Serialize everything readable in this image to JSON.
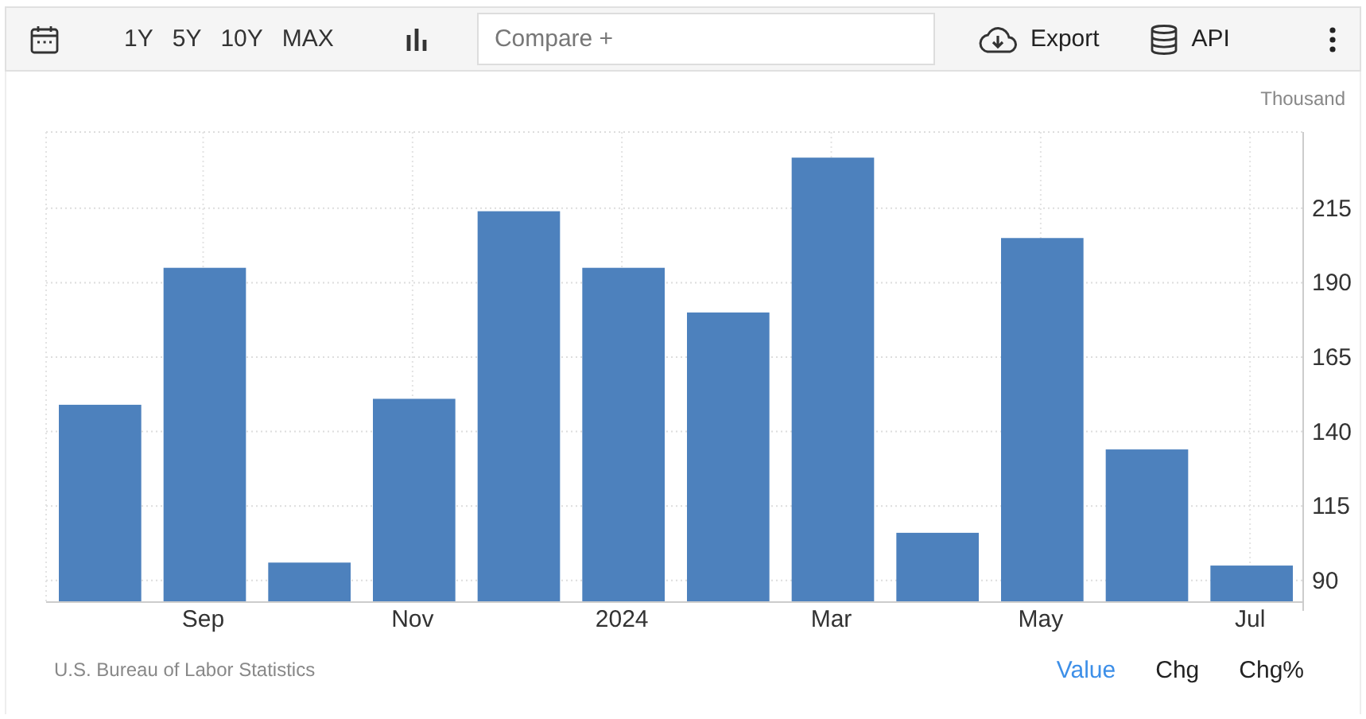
{
  "toolbar": {
    "ranges": [
      {
        "label": "1Y"
      },
      {
        "label": "5Y"
      },
      {
        "label": "10Y"
      },
      {
        "label": "MAX"
      }
    ],
    "compare": {
      "placeholder": "Compare +"
    },
    "export": "Export",
    "api": "API"
  },
  "chart": {
    "unit": "Thousand",
    "chart_data": {
      "type": "bar",
      "categories": [
        null,
        "Sep",
        null,
        "Nov",
        null,
        "2024",
        null,
        "Mar",
        null,
        "May",
        null,
        "Jul"
      ],
      "grid": true,
      "series": [
        {
          "color": "#4d81bd",
          "values": [
            149,
            195,
            96,
            151,
            214,
            195,
            180,
            232,
            106,
            205,
            134,
            95
          ]
        }
      ],
      "ylim": [
        83,
        240.6
      ],
      "yticks": [
        90,
        115,
        140,
        165,
        190,
        215
      ]
    }
  },
  "footer": {
    "source": "U.S. Bureau of Labor Statistics",
    "views": [
      {
        "label": "Value",
        "selected": true
      },
      {
        "label": "Chg",
        "selected": false
      },
      {
        "label": "Chg%",
        "selected": false
      }
    ]
  }
}
